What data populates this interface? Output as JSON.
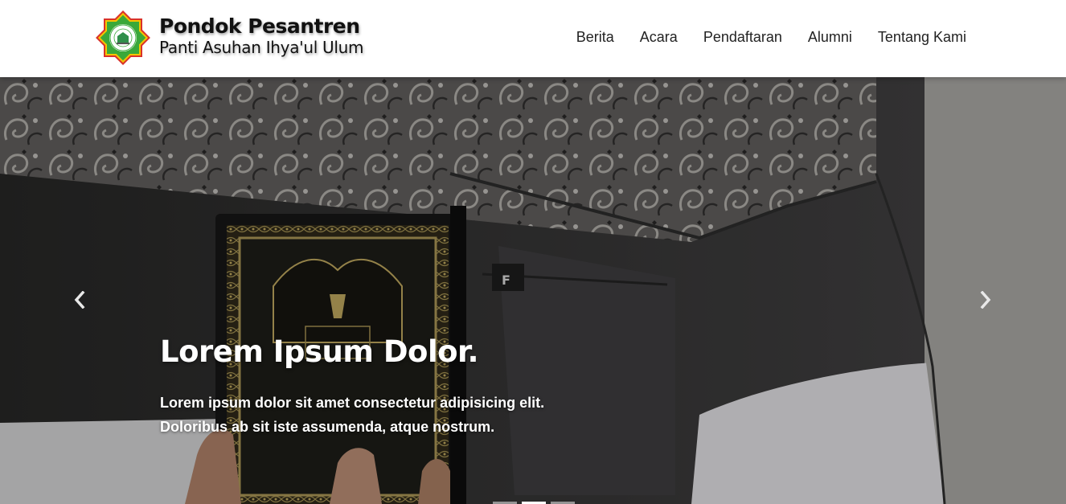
{
  "brand": {
    "title": "Pondok Pesantren",
    "subtitle": "Panti Asuhan Ihya'ul Ulum",
    "logo_icon": "star-seal-logo"
  },
  "nav": {
    "items": [
      {
        "label": "Berita"
      },
      {
        "label": "Acara"
      },
      {
        "label": "Pendaftaran"
      },
      {
        "label": "Alumni"
      },
      {
        "label": "Tentang Kami"
      }
    ]
  },
  "carousel": {
    "prev_icon": "chevron-left-icon",
    "next_icon": "chevron-right-icon",
    "slide": {
      "heading": "Lorem Ipsum Dolor.",
      "text_line1": "Lorem ipsum dolor sit amet consectetur adipisicing elit.",
      "text_line2": "Doloribus ab sit iste assumenda, atque nostrum."
    },
    "indicator_count": 3,
    "active_indicator": 2
  },
  "colors": {
    "nav_bg": "#ffffff",
    "nav_text": "#222222",
    "caption_text": "#ffffff",
    "logo_green": "#3aa839",
    "logo_red": "#d9322a"
  }
}
